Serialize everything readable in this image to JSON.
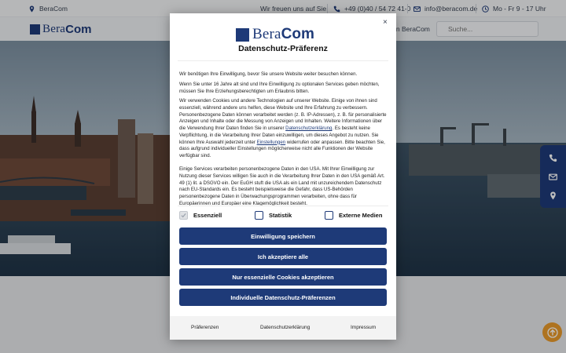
{
  "topbar": {
    "company": "BeraCom",
    "greeting": "Wir freuen uns auf Sie.",
    "phone": "+49 (0)40 / 54 72 41-0",
    "email": "info@beracom.de",
    "hours": "Mo - Fr 9 - 17 Uhr"
  },
  "header": {
    "logo_bera": "Bera",
    "logo_com": "Com",
    "nav_partial": "in BeraCom",
    "search_placeholder": "Suche..."
  },
  "modal": {
    "close_symbol": "×",
    "logo_bera": "Bera",
    "logo_com": "Com",
    "title": "Datenschutz-Präferenz",
    "p1": "Wir benötigen Ihre Einwilligung, bevor Sie unsere Website weiter besuchen können.",
    "p2": "Wenn Sie unter 16 Jahre alt sind und Ihre Einwilligung zu optionalen Services geben möchten, müssen Sie Ihre Erziehungsberechtigten um Erlaubnis bitten.",
    "p3_a": "Wir verwenden Cookies und andere Technologien auf unserer Website. Einige von ihnen sind essenziell, während andere uns helfen, diese Website und Ihre Erfahrung zu verbessern. Personenbezogene Daten können verarbeitet werden (z. B. IP-Adressen), z. B. für personalisierte Anzeigen und Inhalte oder die Messung von Anzeigen und Inhalten. Weitere Informationen über die Verwendung Ihrer Daten finden Sie in unserer ",
    "p3_link1": "Datenschutzerklärung",
    "p3_b": ". Es besteht keine Verpflichtung, in die Verarbeitung Ihrer Daten einzuwilligen, um dieses Angebot zu nutzen. Sie können Ihre Auswahl jederzeit unter ",
    "p3_link2": "Einstellungen",
    "p3_c": " widerrufen oder anpassen. Bitte beachten Sie, dass aufgrund individueller Einstellungen möglicherweise nicht alle Funktionen der Website verfügbar sind.",
    "p4": "Einige Services verarbeiten personenbezogene Daten in den USA. Mit Ihrer Einwilligung zur Nutzung dieser Services willigen Sie auch in die Verarbeitung Ihrer Daten in den USA gemäß Art. 49 (1) lit. a DSGVO ein. Der EuGH stuft die USA als ein Land mit unzureichendem Datenschutz nach EU-Standards ein. Es besteht beispielsweise die Gefahr, dass US-Behörden personenbezogene Daten in Überwachungsprogrammen verarbeiten, ohne dass für Europäerinnen und Europäer eine Klagemöglichkeit besteht.",
    "checkboxes": [
      {
        "label": "Essenziell",
        "checked": true,
        "disabled": true
      },
      {
        "label": "Statistik",
        "checked": false,
        "disabled": false
      },
      {
        "label": "Externe Medien",
        "checked": false,
        "disabled": false
      }
    ],
    "buttons": {
      "save": "Einwilligung speichern",
      "accept_all": "Ich akzeptiere alle",
      "essential_only": "Nur essenzielle Cookies akzeptieren",
      "individual": "Individuelle Datenschutz-Präferenzen"
    },
    "footer": {
      "preferences": "Präferenzen",
      "privacy": "Datenschutzerklärung",
      "imprint": "Impressum"
    }
  },
  "colors": {
    "brand": "#1e3a78",
    "accent_orange": "#e99a2b"
  },
  "icons": [
    "location-pin-icon",
    "phone-icon",
    "mail-icon",
    "clock-icon",
    "close-icon",
    "check-icon",
    "arrow-up-icon"
  ]
}
